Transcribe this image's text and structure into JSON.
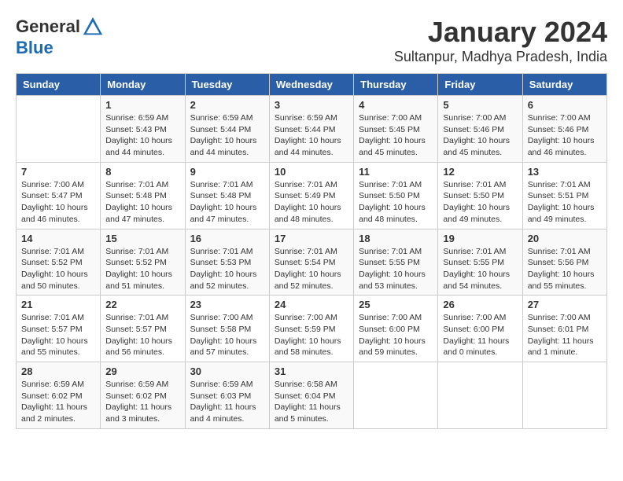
{
  "header": {
    "logo_general": "General",
    "logo_blue": "Blue",
    "month_title": "January 2024",
    "location": "Sultanpur, Madhya Pradesh, India"
  },
  "days_of_week": [
    "Sunday",
    "Monday",
    "Tuesday",
    "Wednesday",
    "Thursday",
    "Friday",
    "Saturday"
  ],
  "weeks": [
    [
      {
        "day": "",
        "detail": ""
      },
      {
        "day": "1",
        "detail": "Sunrise: 6:59 AM\nSunset: 5:43 PM\nDaylight: 10 hours\nand 44 minutes."
      },
      {
        "day": "2",
        "detail": "Sunrise: 6:59 AM\nSunset: 5:44 PM\nDaylight: 10 hours\nand 44 minutes."
      },
      {
        "day": "3",
        "detail": "Sunrise: 6:59 AM\nSunset: 5:44 PM\nDaylight: 10 hours\nand 44 minutes."
      },
      {
        "day": "4",
        "detail": "Sunrise: 7:00 AM\nSunset: 5:45 PM\nDaylight: 10 hours\nand 45 minutes."
      },
      {
        "day": "5",
        "detail": "Sunrise: 7:00 AM\nSunset: 5:46 PM\nDaylight: 10 hours\nand 45 minutes."
      },
      {
        "day": "6",
        "detail": "Sunrise: 7:00 AM\nSunset: 5:46 PM\nDaylight: 10 hours\nand 46 minutes."
      }
    ],
    [
      {
        "day": "7",
        "detail": "Sunrise: 7:00 AM\nSunset: 5:47 PM\nDaylight: 10 hours\nand 46 minutes."
      },
      {
        "day": "8",
        "detail": "Sunrise: 7:01 AM\nSunset: 5:48 PM\nDaylight: 10 hours\nand 47 minutes."
      },
      {
        "day": "9",
        "detail": "Sunrise: 7:01 AM\nSunset: 5:48 PM\nDaylight: 10 hours\nand 47 minutes."
      },
      {
        "day": "10",
        "detail": "Sunrise: 7:01 AM\nSunset: 5:49 PM\nDaylight: 10 hours\nand 48 minutes."
      },
      {
        "day": "11",
        "detail": "Sunrise: 7:01 AM\nSunset: 5:50 PM\nDaylight: 10 hours\nand 48 minutes."
      },
      {
        "day": "12",
        "detail": "Sunrise: 7:01 AM\nSunset: 5:50 PM\nDaylight: 10 hours\nand 49 minutes."
      },
      {
        "day": "13",
        "detail": "Sunrise: 7:01 AM\nSunset: 5:51 PM\nDaylight: 10 hours\nand 49 minutes."
      }
    ],
    [
      {
        "day": "14",
        "detail": "Sunrise: 7:01 AM\nSunset: 5:52 PM\nDaylight: 10 hours\nand 50 minutes."
      },
      {
        "day": "15",
        "detail": "Sunrise: 7:01 AM\nSunset: 5:52 PM\nDaylight: 10 hours\nand 51 minutes."
      },
      {
        "day": "16",
        "detail": "Sunrise: 7:01 AM\nSunset: 5:53 PM\nDaylight: 10 hours\nand 52 minutes."
      },
      {
        "day": "17",
        "detail": "Sunrise: 7:01 AM\nSunset: 5:54 PM\nDaylight: 10 hours\nand 52 minutes."
      },
      {
        "day": "18",
        "detail": "Sunrise: 7:01 AM\nSunset: 5:55 PM\nDaylight: 10 hours\nand 53 minutes."
      },
      {
        "day": "19",
        "detail": "Sunrise: 7:01 AM\nSunset: 5:55 PM\nDaylight: 10 hours\nand 54 minutes."
      },
      {
        "day": "20",
        "detail": "Sunrise: 7:01 AM\nSunset: 5:56 PM\nDaylight: 10 hours\nand 55 minutes."
      }
    ],
    [
      {
        "day": "21",
        "detail": "Sunrise: 7:01 AM\nSunset: 5:57 PM\nDaylight: 10 hours\nand 55 minutes."
      },
      {
        "day": "22",
        "detail": "Sunrise: 7:01 AM\nSunset: 5:57 PM\nDaylight: 10 hours\nand 56 minutes."
      },
      {
        "day": "23",
        "detail": "Sunrise: 7:00 AM\nSunset: 5:58 PM\nDaylight: 10 hours\nand 57 minutes."
      },
      {
        "day": "24",
        "detail": "Sunrise: 7:00 AM\nSunset: 5:59 PM\nDaylight: 10 hours\nand 58 minutes."
      },
      {
        "day": "25",
        "detail": "Sunrise: 7:00 AM\nSunset: 6:00 PM\nDaylight: 10 hours\nand 59 minutes."
      },
      {
        "day": "26",
        "detail": "Sunrise: 7:00 AM\nSunset: 6:00 PM\nDaylight: 11 hours\nand 0 minutes."
      },
      {
        "day": "27",
        "detail": "Sunrise: 7:00 AM\nSunset: 6:01 PM\nDaylight: 11 hours\nand 1 minute."
      }
    ],
    [
      {
        "day": "28",
        "detail": "Sunrise: 6:59 AM\nSunset: 6:02 PM\nDaylight: 11 hours\nand 2 minutes."
      },
      {
        "day": "29",
        "detail": "Sunrise: 6:59 AM\nSunset: 6:02 PM\nDaylight: 11 hours\nand 3 minutes."
      },
      {
        "day": "30",
        "detail": "Sunrise: 6:59 AM\nSunset: 6:03 PM\nDaylight: 11 hours\nand 4 minutes."
      },
      {
        "day": "31",
        "detail": "Sunrise: 6:58 AM\nSunset: 6:04 PM\nDaylight: 11 hours\nand 5 minutes."
      },
      {
        "day": "",
        "detail": ""
      },
      {
        "day": "",
        "detail": ""
      },
      {
        "day": "",
        "detail": ""
      }
    ]
  ]
}
